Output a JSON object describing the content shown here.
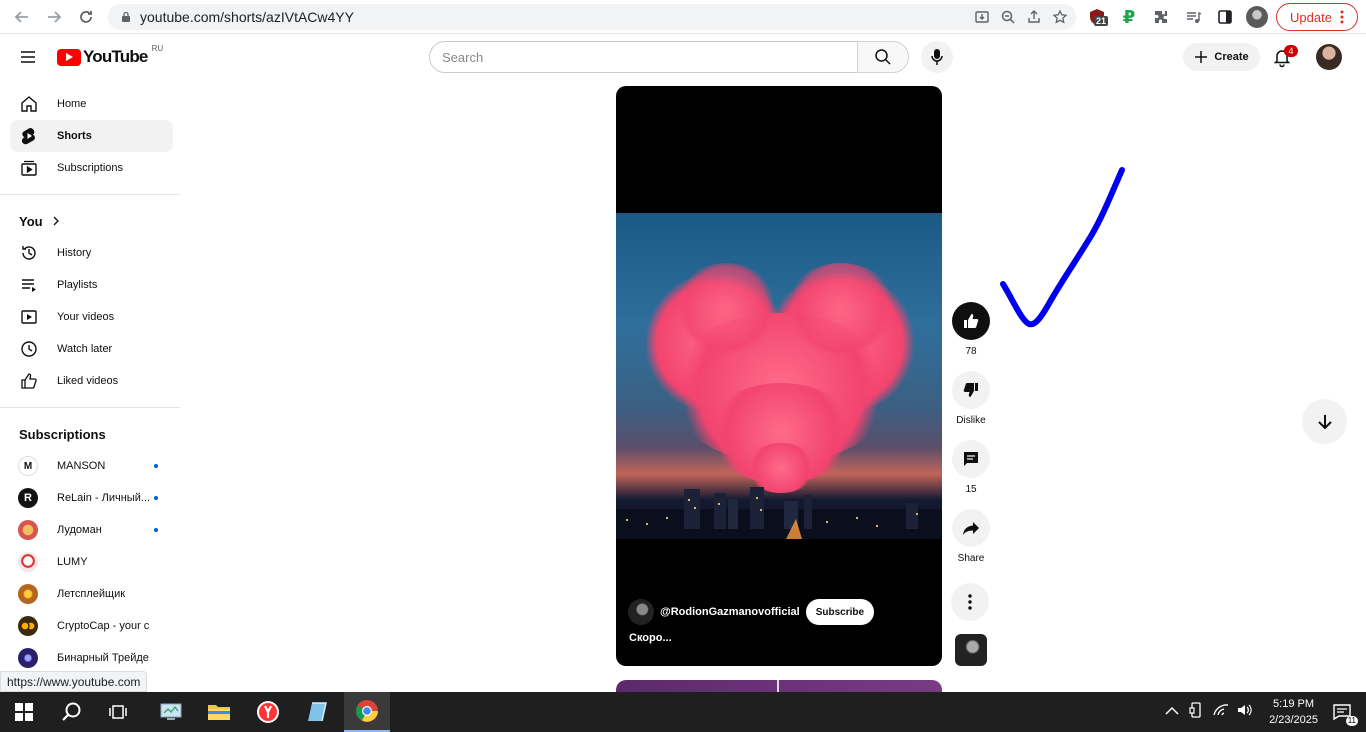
{
  "browser": {
    "url": "youtube.com/shorts/azIVtACw4YY",
    "update_label": "Update",
    "ext_badge": "21"
  },
  "header": {
    "logo_text": "YouTube",
    "region": "RU",
    "search_placeholder": "Search",
    "create_label": "Create",
    "notification_count": "4"
  },
  "sidebar": {
    "main": [
      {
        "label": "Home",
        "icon": "home-icon"
      },
      {
        "label": "Shorts",
        "icon": "shorts-icon",
        "active": true
      },
      {
        "label": "Subscriptions",
        "icon": "subscriptions-icon"
      }
    ],
    "you_label": "You",
    "you_items": [
      {
        "label": "History",
        "icon": "history-icon"
      },
      {
        "label": "Playlists",
        "icon": "playlists-icon"
      },
      {
        "label": "Your videos",
        "icon": "your-videos-icon"
      },
      {
        "label": "Watch later",
        "icon": "watch-later-icon"
      },
      {
        "label": "Liked videos",
        "icon": "liked-videos-icon"
      }
    ],
    "subscriptions_label": "Subscriptions",
    "subscriptions": [
      {
        "name": "MANSON",
        "new": true,
        "color": "#ffffff"
      },
      {
        "name": "ReLain - Личный...",
        "new": true,
        "color": "#111111"
      },
      {
        "name": "Лудоман",
        "new": true,
        "color": "#d9534f"
      },
      {
        "name": "LUMY",
        "new": false,
        "color": "#f3e7e7"
      },
      {
        "name": "Летсплейщик",
        "new": false,
        "color": "#b5651d"
      },
      {
        "name": "CryptoCap - your cr...",
        "new": false,
        "color": "#3a2a10"
      },
      {
        "name": "Бинарный Трейдер",
        "new": false,
        "color": "#2a1f6b"
      }
    ]
  },
  "short": {
    "channel": "@RodionGazmanovofficial",
    "subscribe_label": "Subscribe",
    "title": "Скоро..."
  },
  "actions": {
    "likes": "78",
    "dislike_label": "Dislike",
    "comments": "15",
    "share_label": "Share"
  },
  "status_url": "https://www.youtube.com",
  "taskbar": {
    "time": "5:19 PM",
    "date": "2/23/2025",
    "notif_count": "11"
  },
  "colors": {
    "accent_red": "#ff0000",
    "check_mark": "#0000ee",
    "update_red": "#d93025"
  }
}
